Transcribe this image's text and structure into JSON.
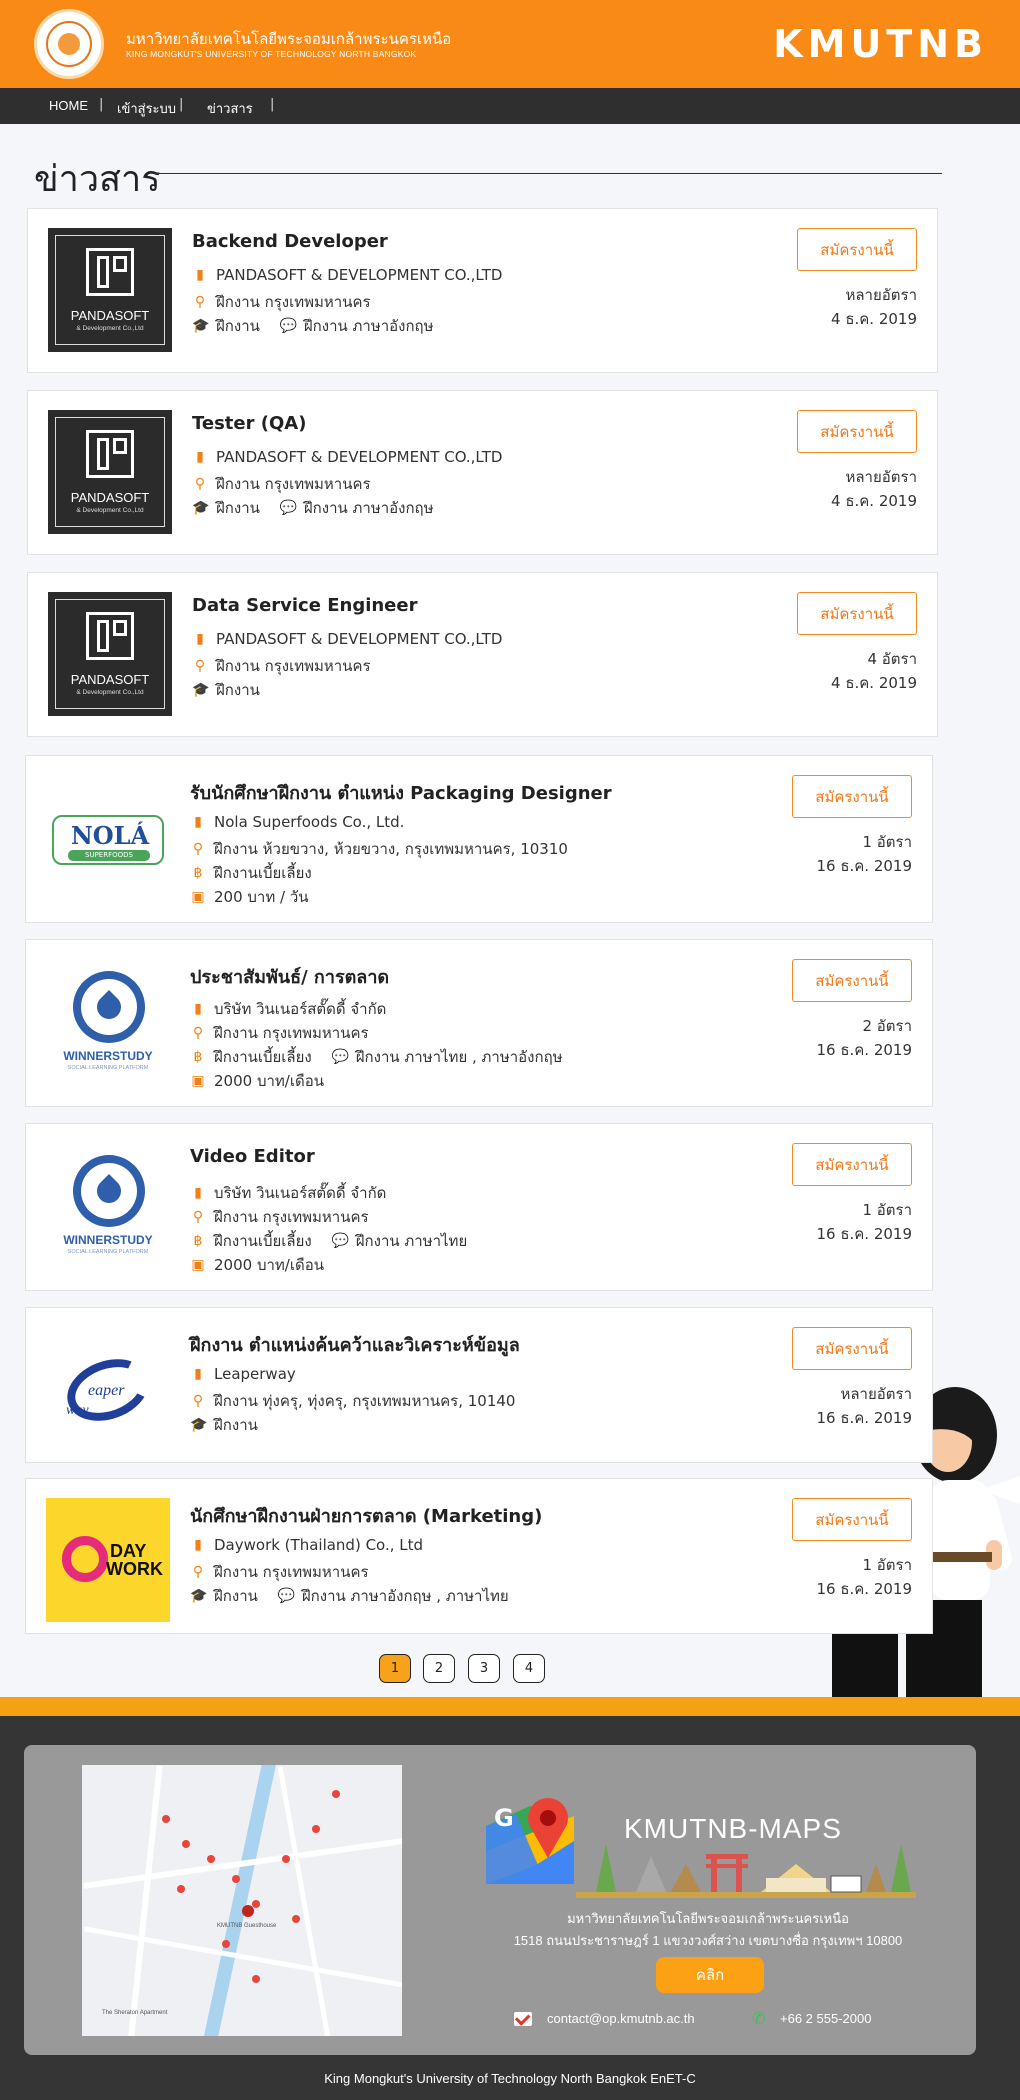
{
  "header": {
    "university_th": "มหาวิทยาลัยเทคโนโลยีพระจอมเกล้าพระนครเหนือ",
    "university_en": "KING MONGKUT'S UNIVERSITY OF TECHNOLOGY NORTH BANGKOK",
    "brand": "KMUTNB"
  },
  "nav": [
    "HOME",
    "เข้าสู่ระบบ",
    "ข่าวสาร"
  ],
  "page_title": "ข่าวสาร",
  "apply_label": "สมัครงานนี้",
  "jobs": [
    {
      "title": "Backend Developer",
      "company": "PANDASOFT & DEVELOPMENT CO.,LTD",
      "location": "ฝึกงาน กรุงเทพมหานคร",
      "type": "ฝึกงาน",
      "language": "ฝึกงาน ภาษาอังกฤษ",
      "openings": "หลายอัตรา",
      "date": "4 ธ.ค. 2019",
      "logo": {
        "name": "PANDASOFT",
        "sub": "& Development Co.,Ltd"
      }
    },
    {
      "title": "Tester (QA)",
      "company": "PANDASOFT & DEVELOPMENT CO.,LTD",
      "location": "ฝึกงาน กรุงเทพมหานคร",
      "type": "ฝึกงาน",
      "language": "ฝึกงาน ภาษาอังกฤษ",
      "openings": "หลายอัตรา",
      "date": "4 ธ.ค. 2019",
      "logo": {
        "name": "PANDASOFT",
        "sub": "& Development Co.,Ltd"
      }
    },
    {
      "title": "Data Service Engineer",
      "company": "PANDASOFT & DEVELOPMENT CO.,LTD",
      "location": "ฝึกงาน กรุงเทพมหานคร",
      "type": "ฝึกงาน",
      "openings": "4 อัตรา",
      "date": "4 ธ.ค. 2019",
      "logo": {
        "name": "PANDASOFT",
        "sub": "& Development Co.,Ltd"
      }
    },
    {
      "title": "รับนักศึกษาฝึกงาน ตำแหน่ง Packaging Designer",
      "company": "Nola Superfoods Co., Ltd.",
      "location": "ฝึกงาน ห้วยขวาง, ห้วยขวาง, กรุงเทพมหานคร, 10310",
      "allowance": "ฝึกงานเบี้ยเลี้ยง",
      "pay": "200 บาท / วัน",
      "openings": "1 อัตรา",
      "date": "16 ธ.ค. 2019",
      "logo": {
        "name": "NOLÁ",
        "sub": "SUPERFOODS"
      }
    },
    {
      "title": "ประชาสัมพันธ์/ การตลาด",
      "company": "บริษัท วินเนอร์สตั๊ดดี้ จำกัด",
      "location": "ฝึกงาน กรุงเทพมหานคร",
      "allowance": "ฝึกงานเบี้ยเลี้ยง",
      "language": "ฝึกงาน ภาษาไทย , ภาษาอังกฤษ",
      "pay": "2000 บาท/เดือน",
      "openings": "2 อัตรา",
      "date": "16 ธ.ค. 2019",
      "logo": {
        "name": "WINNERSTUDY",
        "sub": "SOCIAL LEARNING PLATFORM"
      }
    },
    {
      "title": "Video Editor",
      "company": "บริษัท วินเนอร์สตั๊ดดี้ จำกัด",
      "location": "ฝึกงาน กรุงเทพมหานคร",
      "allowance": "ฝึกงานเบี้ยเลี้ยง",
      "language": "ฝึกงาน ภาษาไทย",
      "pay": "2000 บาท/เดือน",
      "openings": "1 อัตรา",
      "date": "16 ธ.ค. 2019",
      "logo": {
        "name": "WINNERSTUDY",
        "sub": "SOCIAL LEARNING PLATFORM"
      }
    },
    {
      "title": "ฝึกงาน ตำแหน่งค้นคว้าและวิเคราะห์ข้อมูล",
      "company": "Leaperway",
      "location": "ฝึกงาน ทุ่งครุ, ทุ่งครุ, กรุงเทพมหานคร, 10140",
      "type": "ฝึกงาน",
      "openings": "หลายอัตรา",
      "date": "16 ธ.ค. 2019",
      "logo": {
        "name": "eaper",
        "sub": "way"
      }
    },
    {
      "title": "นักศึกษาฝึกงานฝ่ายการตลาด (Marketing)",
      "company": "Daywork (Thailand) Co., Ltd",
      "location": "ฝึกงาน กรุงเทพมหานคร",
      "type": "ฝึกงาน",
      "language": "ฝึกงาน ภาษาอังกฤษ , ภาษาไทย",
      "openings": "1 อัตรา",
      "date": "16 ธ.ค. 2019",
      "logo": {
        "name": "DAY",
        "sub": "WORK"
      }
    }
  ],
  "pagination": [
    "1",
    "2",
    "3",
    "4"
  ],
  "pagination_active": "1",
  "footer": {
    "maps_title": "KMUTNB-MAPS",
    "address_line1": "มหาวิทยาลัยเทคโนโลยีพระจอมเกล้าพระนครเหนือ",
    "address_line2": "1518 ถนนประชาราษฎร์ 1 แขวงวงศ์สว่าง เขตบางซื่อ กรุงเทพฯ 10800",
    "click_label": "คลิก",
    "email": "contact@op.kmutnb.ac.th",
    "phone": "+66 2 555-2000",
    "copyright": "King Mongkut's University of Technology North Bangkok EnET-C",
    "map_labels": [
      "KMUTNB Guesthouse",
      "The Sheraton Apartment"
    ]
  },
  "colors": {
    "brand_orange": "#fa8a16",
    "nav_dark": "#2f2f2f",
    "footer_dark": "#353535",
    "page_active": "#f7a21b"
  }
}
